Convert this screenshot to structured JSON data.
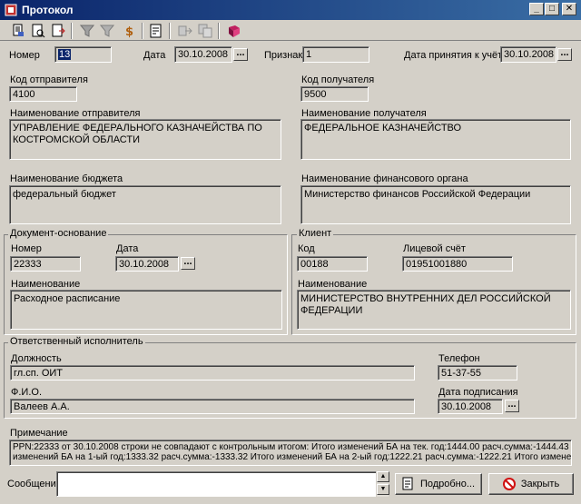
{
  "window": {
    "title": "Протокол"
  },
  "titlebar_buttons": {
    "minimize": "_",
    "maximize": "□",
    "close": "✕"
  },
  "header": {
    "number_label": "Номер",
    "number_value": "13",
    "date_label": "Дата",
    "date_value": "30.10.2008",
    "sign_label": "Признак",
    "sign_value": "1",
    "accept_date_label": "Дата принятия к учёту",
    "accept_date_value": "30.10.2008"
  },
  "sender": {
    "code_label": "Код отправителя",
    "code_value": "4100",
    "name_label": "Наименование отправителя",
    "name_value": "УПРАВЛЕНИЕ ФЕДЕРАЛЬНОГО КАЗНАЧЕЙСТВА ПО КОСТРОМСКОЙ ОБЛАСТИ"
  },
  "receiver": {
    "code_label": "Код получателя",
    "code_value": "9500",
    "name_label": "Наименование получателя",
    "name_value": "ФЕДЕРАЛЬНОЕ КАЗНАЧЕЙСТВО"
  },
  "budget": {
    "label": "Наименование бюджета",
    "value": "федеральный бюджет"
  },
  "fin_org": {
    "label": "Наименование финансового органа",
    "value": "Министерство финансов Российской Федерации"
  },
  "doc_basis": {
    "caption": "Документ-основание",
    "number_label": "Номер",
    "number_value": "22333",
    "date_label": "Дата",
    "date_value": "30.10.2008",
    "name_label": "Наименование",
    "name_value": "Расходное расписание"
  },
  "client": {
    "caption": "Клиент",
    "code_label": "Код",
    "code_value": "00188",
    "account_label": "Лицевой счёт",
    "account_value": "01951001880",
    "name_label": "Наименование",
    "name_value": "МИНИСТЕРСТВО ВНУТРЕННИХ ДЕЛ РОССИЙСКОЙ ФЕДЕРАЦИИ"
  },
  "responsible": {
    "caption": "Ответственный исполнитель",
    "position_label": "Должность",
    "position_value": "гл.сп. ОИТ",
    "phone_label": "Телефон",
    "phone_value": "51-37-55",
    "fio_label": "Ф.И.О.",
    "fio_value": "Валеев А.А.",
    "sign_date_label": "Дата подписания",
    "sign_date_value": "30.10.2008"
  },
  "note": {
    "label": "Примечание",
    "line1": "PPN:22333 от 30.10.2008 строки не совпадают с контрольным итогом:   Итого изменений БА на тек. год:1444.00 расч.сумма:-1444.43   Итого",
    "line2": "изменений БА на 1-ый год:1333.32 расч.сумма:-1333.32   Итого изменений БА на 2-ый год:1222.21 расч.сумма:-1222.21   Итого изменений"
  },
  "footer": {
    "message_label": "Сообщение",
    "message_value": "",
    "details_button": "Подробно...",
    "close_button": "Закрыть"
  },
  "colors": {
    "title_start": "#0a246a",
    "title_end": "#3a6ea5",
    "face": "#d4d0c8"
  }
}
